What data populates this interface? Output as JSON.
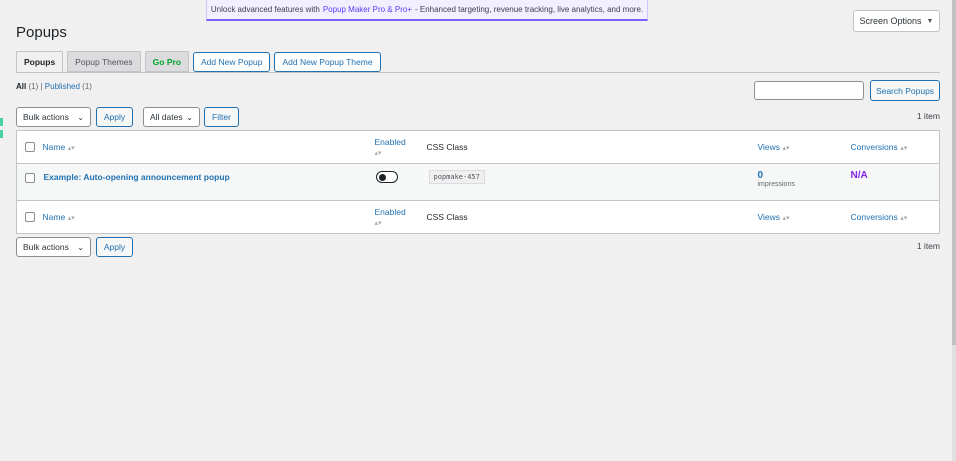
{
  "banner": {
    "text_before": "Unlock advanced features with",
    "link": "Popup Maker Pro & Pro+",
    "text_after": "- Enhanced targeting, revenue tracking, live analytics, and more."
  },
  "screen_options": {
    "label": "Screen Options",
    "caret": "▼"
  },
  "page": {
    "title": "Popups"
  },
  "tabs": [
    {
      "label": "Popups"
    },
    {
      "label": "Popup Themes"
    },
    {
      "label": "Go Pro"
    },
    {
      "label": "Add New Popup"
    },
    {
      "label": "Add New Popup Theme"
    }
  ],
  "views": {
    "all_label": "All",
    "all_count": "(1)",
    "separator": "|",
    "published_label": "Published",
    "published_count": "(1)"
  },
  "search": {
    "value": "",
    "button": "Search Popups"
  },
  "top_nav": {
    "bulk_actions": "Bulk actions",
    "apply": "Apply",
    "dates": "All dates",
    "filter": "Filter",
    "count": "1 item"
  },
  "bottom_nav": {
    "bulk_actions": "Bulk actions",
    "apply": "Apply",
    "count": "1 item"
  },
  "table": {
    "columns": {
      "name": "Name",
      "enabled": "Enabled",
      "css_class": "CSS Class",
      "views": "Views",
      "conversions": "Conversions"
    },
    "sort_icon": "▴▾",
    "rows": [
      {
        "name": "Example: Auto-opening announcement popup",
        "enabled": false,
        "css_class": "popmake-457",
        "views": "0",
        "views_sub": "impressions",
        "conversions": "N/A"
      }
    ]
  },
  "colors": {
    "link": "#2271b1",
    "go_pro": "#00a32a",
    "conversions": "#8224e3",
    "banner_accent": "#7b61ff"
  }
}
